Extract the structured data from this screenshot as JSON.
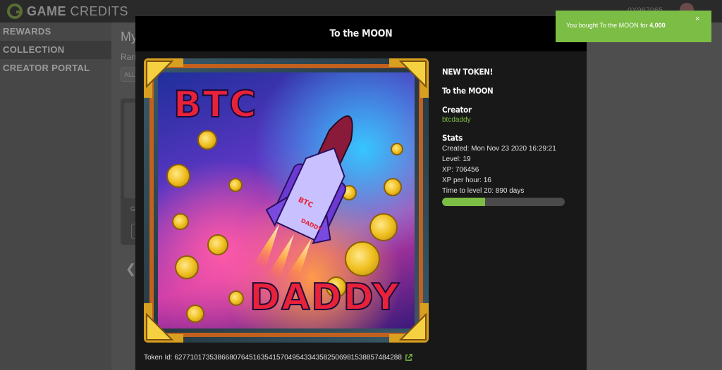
{
  "app": {
    "logo_bold": "GAME",
    "logo_rest": " CREDITS",
    "wallet": "0X967065"
  },
  "sidebar": {
    "items": [
      {
        "label": "REWARDS"
      },
      {
        "label": "COLLECTION"
      },
      {
        "label": "CREATOR PORTAL"
      }
    ]
  },
  "main": {
    "title": "My",
    "rarity_label": "Rarit",
    "filter": "ALL",
    "card_label": "Ga",
    "prev_arrow": "❮"
  },
  "modal": {
    "title": "To the MOON",
    "art": {
      "top_text": "BTC",
      "bottom_text": "DADDY",
      "rocket_text_1": "BTC",
      "rocket_text_2": "DADDY"
    },
    "info": {
      "badge": "NEW TOKEN!",
      "token_name": "To the MOON",
      "creator_heading": "Creator",
      "creator_name": "btcdaddy",
      "stats_heading": "Stats",
      "created": "Created: Mon Nov 23 2020 16:29:21",
      "level": "Level: 19",
      "xp": "XP: 706456",
      "xp_per_hour": "XP per hour: 16",
      "time_to_level": "Time to level 20: 890 days",
      "progress_fraction": 0.35
    },
    "token_id": "Token Id: 62771017353866807645163541570495433435825069815388574842​88"
  },
  "toast": {
    "message_prefix": "You bought To the MOON for ",
    "amount": "4,000",
    "close": "×"
  },
  "colors": {
    "accent": "#7cbd45",
    "modal_bg": "#181818",
    "header_bg": "#000000",
    "overlay": "#585858"
  }
}
